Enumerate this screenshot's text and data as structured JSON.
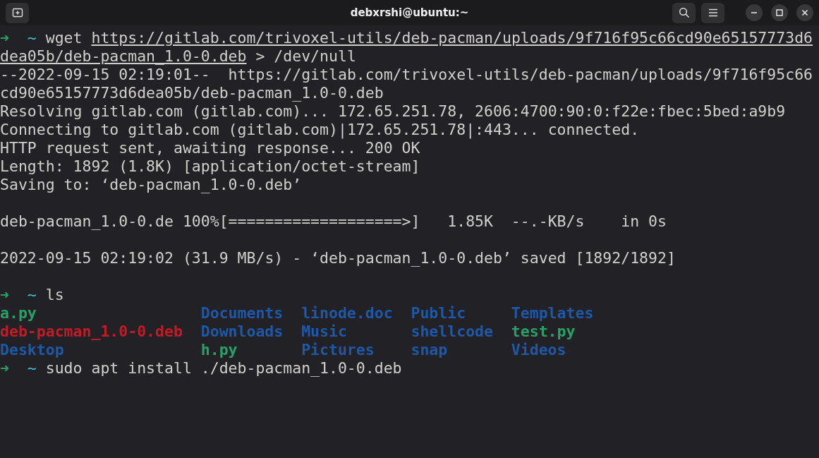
{
  "window": {
    "title": "debxrshi@ubuntu:~"
  },
  "terminal": {
    "lines": [
      {
        "kind": "text",
        "segments": [
          {
            "kind": "arrow",
            "text": "➜"
          },
          {
            "kind": "cwd",
            "text": "~"
          },
          {
            "kind": "plain",
            "text": "wget "
          },
          {
            "kind": "link",
            "text": "https://gitlab.com/trivoxel-utils/deb-pacman/uploads/9f716f95c66cd90e65157773d6"
          }
        ]
      },
      {
        "kind": "text",
        "segments": [
          {
            "kind": "link",
            "text": "dea05b/deb-pacman_1.0-0.deb"
          },
          {
            "kind": "plain",
            "text": " > /dev/null"
          }
        ]
      },
      {
        "kind": "text",
        "segments": [
          {
            "kind": "plain",
            "text": "--2022-09-15 02:19:01--  https://gitlab.com/trivoxel-utils/deb-pacman/uploads/9f716f95c66"
          }
        ]
      },
      {
        "kind": "text",
        "segments": [
          {
            "kind": "plain",
            "text": "cd90e65157773d6dea05b/deb-pacman_1.0-0.deb"
          }
        ]
      },
      {
        "kind": "text",
        "segments": [
          {
            "kind": "plain",
            "text": "Resolving gitlab.com (gitlab.com)... 172.65.251.78, 2606:4700:90:0:f22e:fbec:5bed:a9b9"
          }
        ]
      },
      {
        "kind": "text",
        "segments": [
          {
            "kind": "plain",
            "text": "Connecting to gitlab.com (gitlab.com)|172.65.251.78|:443... connected."
          }
        ]
      },
      {
        "kind": "text",
        "segments": [
          {
            "kind": "plain",
            "text": "HTTP request sent, awaiting response... 200 OK"
          }
        ]
      },
      {
        "kind": "text",
        "segments": [
          {
            "kind": "plain",
            "text": "Length: 1892 (1.8K) [application/octet-stream]"
          }
        ]
      },
      {
        "kind": "text",
        "segments": [
          {
            "kind": "plain",
            "text": "Saving to: ‘deb-pacman_1.0-0.deb’"
          }
        ]
      },
      {
        "kind": "blank"
      },
      {
        "kind": "text",
        "segments": [
          {
            "kind": "plain",
            "text": "deb-pacman_1.0-0.de 100%[===================>]   1.85K  --.-KB/s    in 0s"
          }
        ]
      },
      {
        "kind": "blank"
      },
      {
        "kind": "text",
        "segments": [
          {
            "kind": "plain",
            "text": "2022-09-15 02:19:02 (31.9 MB/s) - ‘deb-pacman_1.0-0.deb’ saved [1892/1892]"
          }
        ]
      },
      {
        "kind": "blank"
      },
      {
        "kind": "text",
        "segments": [
          {
            "kind": "arrow",
            "text": "➜"
          },
          {
            "kind": "cwd",
            "text": "~"
          },
          {
            "kind": "plain",
            "text": "ls"
          }
        ]
      },
      {
        "kind": "listing",
        "rows": [
          [
            {
              "kind": "executable",
              "text": "a.py"
            },
            {
              "kind": "directory",
              "text": "Documents"
            },
            {
              "kind": "directory",
              "text": "linode.doc"
            },
            {
              "kind": "directory",
              "text": "Public"
            },
            {
              "kind": "directory",
              "text": "Templates"
            }
          ],
          [
            {
              "kind": "archive",
              "text": "deb-pacman_1.0-0.deb"
            },
            {
              "kind": "directory",
              "text": "Downloads"
            },
            {
              "kind": "directory",
              "text": "Music"
            },
            {
              "kind": "directory",
              "text": "shellcode"
            },
            {
              "kind": "executable",
              "text": "test.py"
            }
          ],
          [
            {
              "kind": "directory",
              "text": "Desktop"
            },
            {
              "kind": "executable",
              "text": "h.py"
            },
            {
              "kind": "directory",
              "text": "Pictures"
            },
            {
              "kind": "directory",
              "text": "snap"
            },
            {
              "kind": "directory",
              "text": "Videos"
            }
          ]
        ]
      },
      {
        "kind": "text",
        "segments": [
          {
            "kind": "arrow",
            "text": "➜"
          },
          {
            "kind": "cwd",
            "text": "~"
          },
          {
            "kind": "plain",
            "text": "sudo apt install ./deb-pacman_1.0-0.deb"
          }
        ]
      }
    ]
  }
}
